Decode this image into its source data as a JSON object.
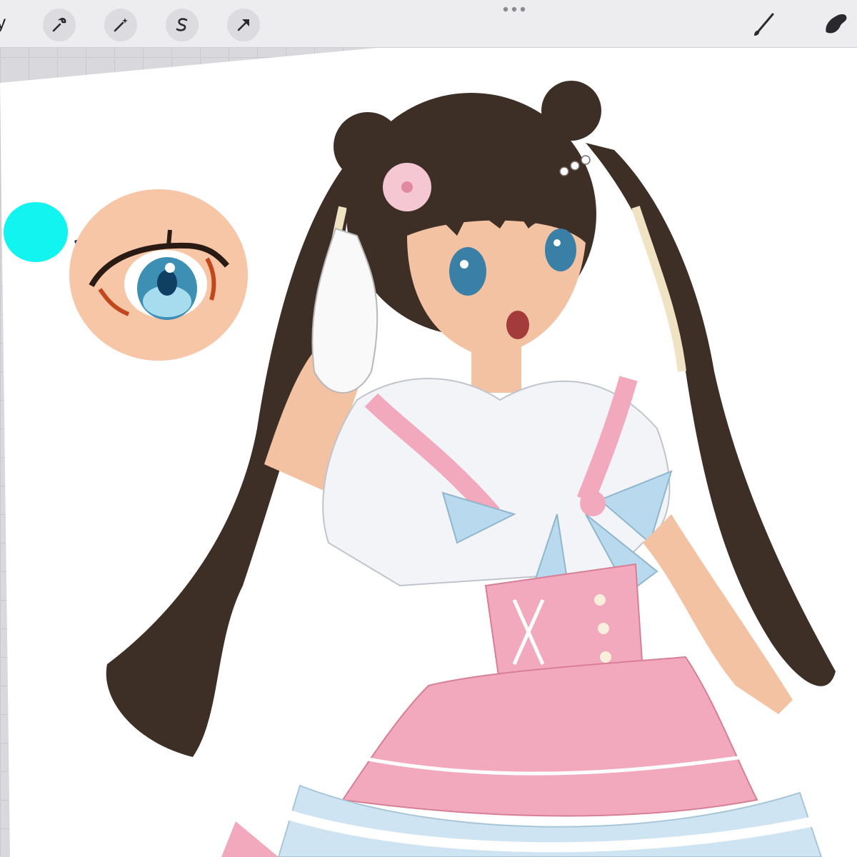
{
  "toolbar": {
    "gallery_label": "ery",
    "left_tools": [
      {
        "icon": "wrench-icon",
        "name": "actions"
      },
      {
        "icon": "magic-wand-icon",
        "name": "adjustments"
      },
      {
        "icon": "selection-s-icon",
        "name": "selection"
      },
      {
        "icon": "transform-arrow-icon",
        "name": "transform"
      }
    ],
    "center_icon": "more-dots-icon",
    "right_tools": [
      {
        "icon": "brush-icon",
        "name": "paint"
      },
      {
        "icon": "smudge-icon",
        "name": "smudge"
      }
    ]
  },
  "canvas": {
    "description_colors": {
      "paper": "#ffffff",
      "swatch": "#12f4f0",
      "skin_circle": "#f6c7a7",
      "hair": "#3e2f26",
      "dress_pink": "#f3a9bd",
      "bow_blue": "#b9daee"
    }
  }
}
